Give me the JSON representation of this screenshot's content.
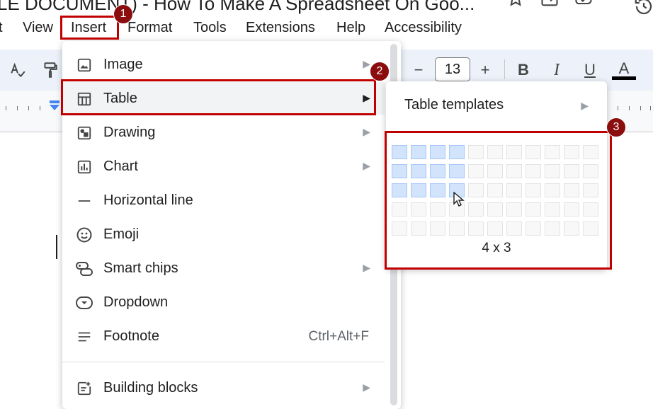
{
  "doc": {
    "title": "LE DOCUMENT) - How To Make A Spreadsheet On Goo..."
  },
  "menubar": {
    "items": [
      "t",
      "View",
      "Insert",
      "Format",
      "Tools",
      "Extensions",
      "Help",
      "Accessibility"
    ]
  },
  "toolbar": {
    "font_size": "13",
    "minus": "−",
    "plus": "+",
    "bold": "B",
    "italic": "I",
    "underline": "U",
    "text_color": "A"
  },
  "insert_menu": {
    "items": [
      {
        "label": "Image",
        "icon": "image-icon",
        "has_submenu": true
      },
      {
        "label": "Table",
        "icon": "table-icon",
        "has_submenu": true
      },
      {
        "label": "Drawing",
        "icon": "drawing-icon",
        "has_submenu": true
      },
      {
        "label": "Chart",
        "icon": "chart-icon",
        "has_submenu": true
      },
      {
        "label": "Horizontal line",
        "icon": "horizontal-line-icon",
        "has_submenu": false
      },
      {
        "label": "Emoji",
        "icon": "emoji-icon",
        "has_submenu": false
      },
      {
        "label": "Smart chips",
        "icon": "smart-chips-icon",
        "has_submenu": true
      },
      {
        "label": "Dropdown",
        "icon": "dropdown-icon",
        "has_submenu": false
      },
      {
        "label": "Footnote",
        "icon": "footnote-icon",
        "has_submenu": false,
        "shortcut": "Ctrl+Alt+F"
      },
      {
        "label": "Building blocks",
        "icon": "building-blocks-icon",
        "has_submenu": true
      }
    ]
  },
  "table_submenu": {
    "templates_label": "Table templates",
    "grid_cols": 11,
    "grid_rows": 5,
    "selected_cols": 4,
    "selected_rows": 3,
    "size_label": "4 x 3"
  },
  "annotations": {
    "badge_1": "1",
    "badge_2": "2",
    "badge_3": "3",
    "highlight_color": "#c00000",
    "badge_color": "#8b0d0d"
  },
  "colors": {
    "toolbar_bg": "#edf2fa",
    "grid_selected": "#d2e3fc",
    "hover_bg": "#f1f3f4"
  }
}
